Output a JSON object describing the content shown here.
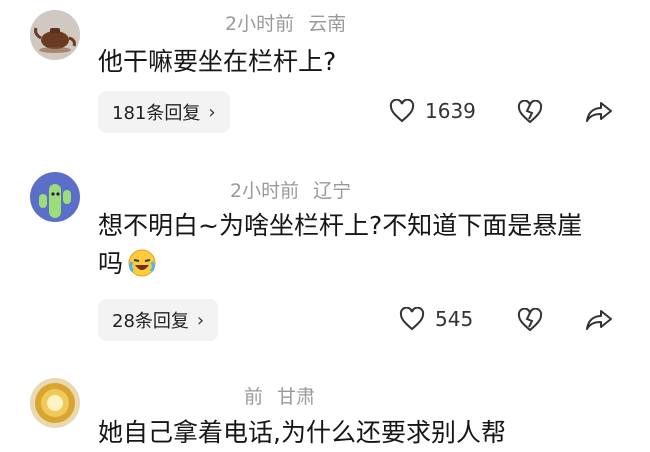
{
  "comments": [
    {
      "time": "2小时前",
      "location": "云南",
      "text": "他干嘛要坐在栏杆上?",
      "replies": "181条回复",
      "likes": "1639"
    },
    {
      "time": "2小时前",
      "location": "辽宁",
      "text": "想不明白~为啥坐栏杆上?不知道下面是悬崖吗",
      "replies": "28条回复",
      "likes": "545"
    },
    {
      "time": "前",
      "location": "甘肃",
      "text": "她自己拿着电话,为什么还要求别人帮"
    }
  ],
  "icons": {
    "like": "heart-icon",
    "dislike": "broken-heart-icon",
    "share": "share-arrow-icon",
    "emoji": "laughing-crying-emoji"
  }
}
